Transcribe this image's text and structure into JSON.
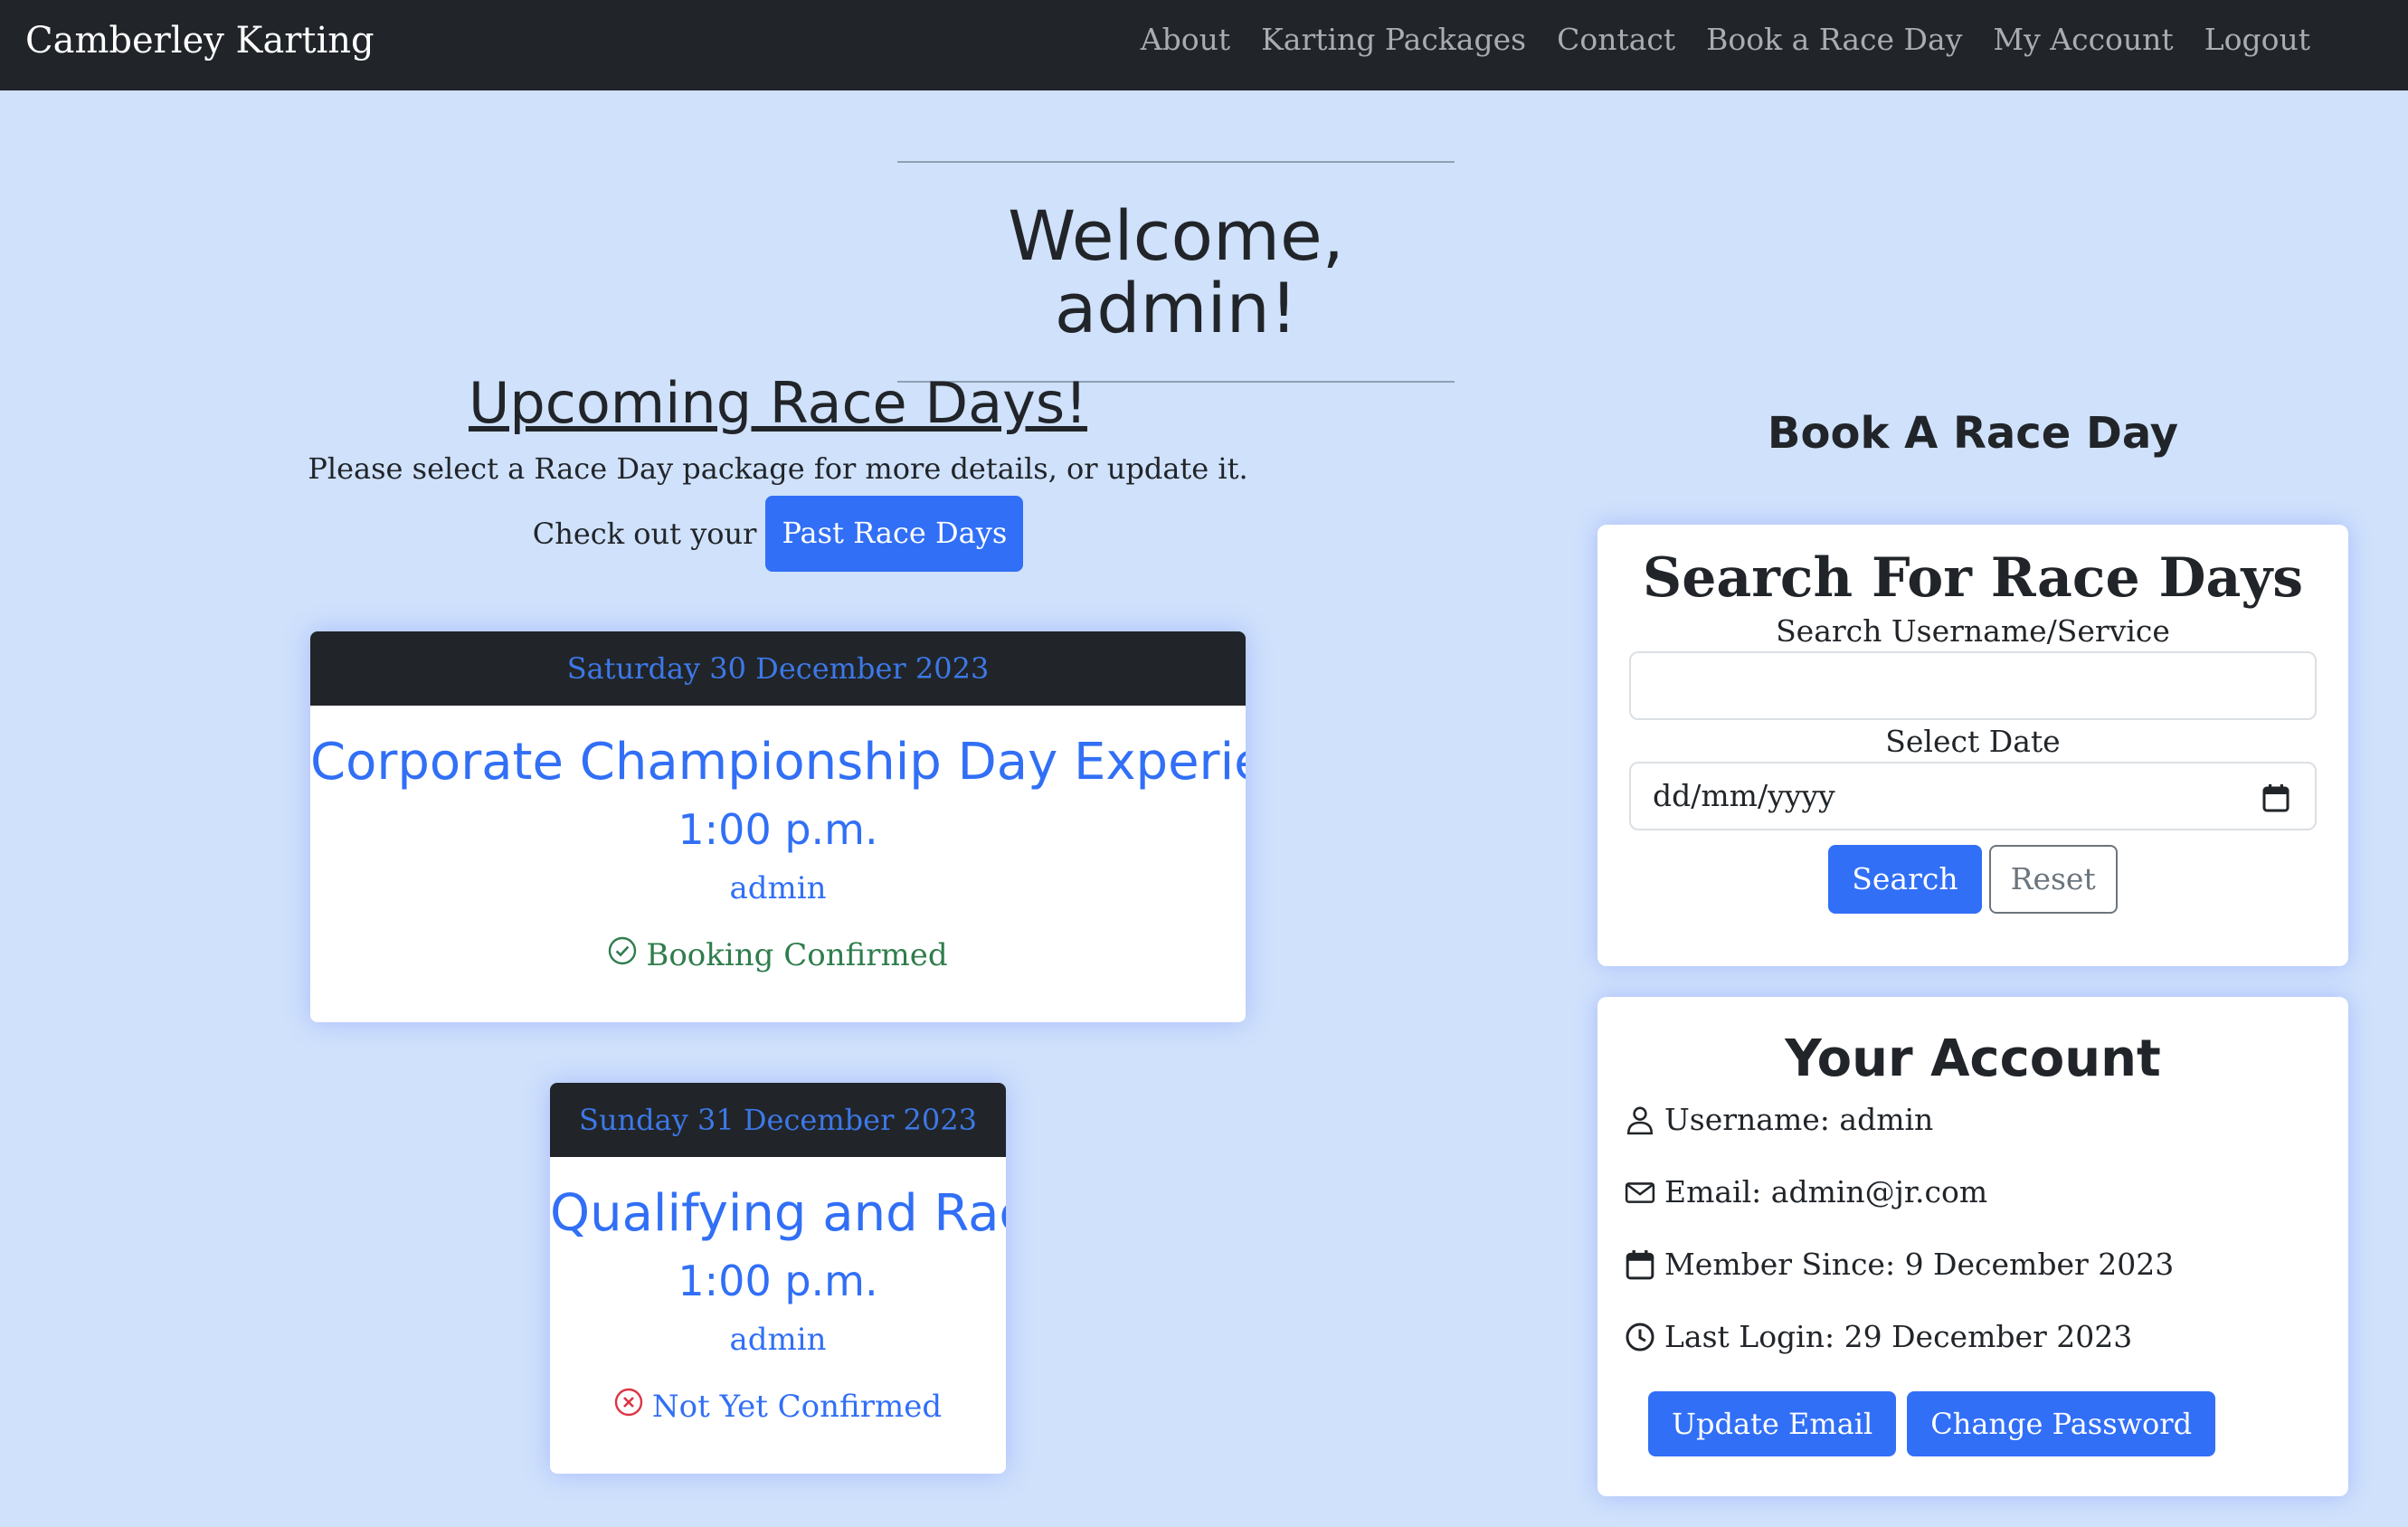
{
  "navbar": {
    "brand": "Camberley Karting",
    "links": [
      "About",
      "Karting Packages",
      "Contact",
      "Book a Race Day",
      "My Account",
      "Logout"
    ]
  },
  "welcome": {
    "title": "Welcome, admin!"
  },
  "upcoming": {
    "title": "Upcoming Race Days!",
    "subtitle": "Please select a Race Day package for more details, or update it.",
    "checkout_text": "Check out your",
    "past_button": "Past Race Days"
  },
  "race_days": [
    {
      "date": "Saturday 30 December 2023",
      "package": "Corporate Championship Day Experience",
      "time": "1:00 p.m.",
      "user": "admin",
      "status": "Booking Confirmed",
      "status_icon": "check-circle-icon",
      "status_color": "#2f7d4c"
    },
    {
      "date": "Sunday 31 December 2023",
      "package": "Qualifying and Race",
      "time": "1:00 p.m.",
      "user": "admin",
      "status": "Not Yet Confirmed",
      "status_icon": "x-circle-icon",
      "status_color": "#dc3545"
    }
  ],
  "book": {
    "heading": "Book A Race Day",
    "search_title": "Search For Race Days",
    "search_label": "Search Username/Service",
    "search_value": "",
    "date_label": "Select Date",
    "date_placeholder": "dd/mm/yyyy",
    "search_button": "Search",
    "reset_button": "Reset"
  },
  "account": {
    "title": "Your Account",
    "username": "Username: admin",
    "email": "Email: admin@jr.com",
    "member_since": "Member Since: 9 December 2023",
    "last_login": "Last Login: 29 December 2023",
    "update_email_button": "Update Email",
    "change_password_button": "Change Password"
  },
  "colors": {
    "background": "#cfe1fb",
    "navbar": "#212529",
    "primary": "#316ff6",
    "success": "#2f7d4c",
    "danger": "#dc3545"
  }
}
